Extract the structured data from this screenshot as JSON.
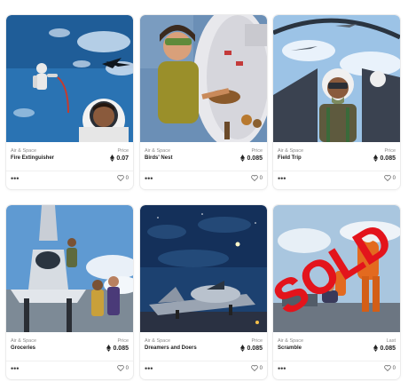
{
  "cards": [
    {
      "collection": "Air & Space",
      "title": "Fire Extinguisher",
      "price_label": "Price",
      "price": "0.07",
      "likes": "0",
      "more": "•••",
      "art": "astronaut-space",
      "sold": false
    },
    {
      "collection": "Air & Space",
      "title": "Birds' Nest",
      "price_label": "Price",
      "price": "0.085",
      "likes": "0",
      "more": "•••",
      "art": "birds-nest",
      "sold": false
    },
    {
      "collection": "Air & Space",
      "title": "Field Trip",
      "price_label": "Price",
      "price": "0.085",
      "likes": "0",
      "more": "•••",
      "art": "pilot-cockpit",
      "sold": false
    },
    {
      "collection": "Air & Space",
      "title": "Groceries",
      "price_label": "Price",
      "price": "0.085",
      "likes": "0",
      "more": "•••",
      "art": "jet-crew",
      "sold": false
    },
    {
      "collection": "Air & Space",
      "title": "Dreamers and Doers",
      "price_label": "Price",
      "price": "0.085",
      "likes": "0",
      "more": "•••",
      "art": "night-jet",
      "sold": false
    },
    {
      "collection": "Air & Space",
      "title": "Scramble",
      "price_label": "Last",
      "price": "0.085",
      "likes": "0",
      "more": "•••",
      "art": "scramble",
      "sold": true,
      "sold_text": "SOLD"
    }
  ],
  "icons": {
    "price": "eth-icon",
    "likes": "heart-icon",
    "more": "more-icon"
  },
  "colors": {
    "sold": "#e3141c"
  }
}
